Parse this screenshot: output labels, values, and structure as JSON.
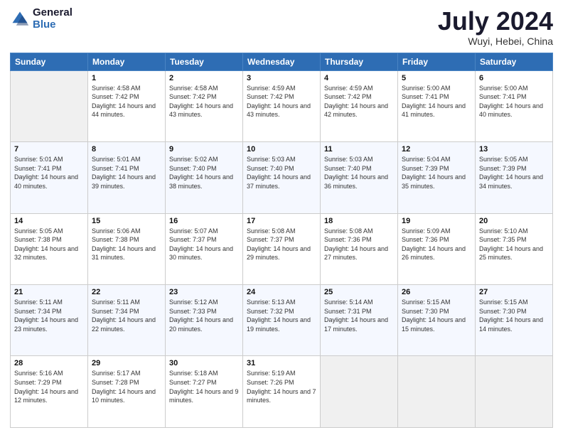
{
  "header": {
    "logo_general": "General",
    "logo_blue": "Blue",
    "month": "July 2024",
    "location": "Wuyi, Hebei, China"
  },
  "days_of_week": [
    "Sunday",
    "Monday",
    "Tuesday",
    "Wednesday",
    "Thursday",
    "Friday",
    "Saturday"
  ],
  "weeks": [
    [
      {
        "day": "",
        "sunrise": "",
        "sunset": "",
        "daylight": ""
      },
      {
        "day": "1",
        "sunrise": "Sunrise: 4:58 AM",
        "sunset": "Sunset: 7:42 PM",
        "daylight": "Daylight: 14 hours and 44 minutes."
      },
      {
        "day": "2",
        "sunrise": "Sunrise: 4:58 AM",
        "sunset": "Sunset: 7:42 PM",
        "daylight": "Daylight: 14 hours and 43 minutes."
      },
      {
        "day": "3",
        "sunrise": "Sunrise: 4:59 AM",
        "sunset": "Sunset: 7:42 PM",
        "daylight": "Daylight: 14 hours and 43 minutes."
      },
      {
        "day": "4",
        "sunrise": "Sunrise: 4:59 AM",
        "sunset": "Sunset: 7:42 PM",
        "daylight": "Daylight: 14 hours and 42 minutes."
      },
      {
        "day": "5",
        "sunrise": "Sunrise: 5:00 AM",
        "sunset": "Sunset: 7:41 PM",
        "daylight": "Daylight: 14 hours and 41 minutes."
      },
      {
        "day": "6",
        "sunrise": "Sunrise: 5:00 AM",
        "sunset": "Sunset: 7:41 PM",
        "daylight": "Daylight: 14 hours and 40 minutes."
      }
    ],
    [
      {
        "day": "7",
        "sunrise": "Sunrise: 5:01 AM",
        "sunset": "Sunset: 7:41 PM",
        "daylight": "Daylight: 14 hours and 40 minutes."
      },
      {
        "day": "8",
        "sunrise": "Sunrise: 5:01 AM",
        "sunset": "Sunset: 7:41 PM",
        "daylight": "Daylight: 14 hours and 39 minutes."
      },
      {
        "day": "9",
        "sunrise": "Sunrise: 5:02 AM",
        "sunset": "Sunset: 7:40 PM",
        "daylight": "Daylight: 14 hours and 38 minutes."
      },
      {
        "day": "10",
        "sunrise": "Sunrise: 5:03 AM",
        "sunset": "Sunset: 7:40 PM",
        "daylight": "Daylight: 14 hours and 37 minutes."
      },
      {
        "day": "11",
        "sunrise": "Sunrise: 5:03 AM",
        "sunset": "Sunset: 7:40 PM",
        "daylight": "Daylight: 14 hours and 36 minutes."
      },
      {
        "day": "12",
        "sunrise": "Sunrise: 5:04 AM",
        "sunset": "Sunset: 7:39 PM",
        "daylight": "Daylight: 14 hours and 35 minutes."
      },
      {
        "day": "13",
        "sunrise": "Sunrise: 5:05 AM",
        "sunset": "Sunset: 7:39 PM",
        "daylight": "Daylight: 14 hours and 34 minutes."
      }
    ],
    [
      {
        "day": "14",
        "sunrise": "Sunrise: 5:05 AM",
        "sunset": "Sunset: 7:38 PM",
        "daylight": "Daylight: 14 hours and 32 minutes."
      },
      {
        "day": "15",
        "sunrise": "Sunrise: 5:06 AM",
        "sunset": "Sunset: 7:38 PM",
        "daylight": "Daylight: 14 hours and 31 minutes."
      },
      {
        "day": "16",
        "sunrise": "Sunrise: 5:07 AM",
        "sunset": "Sunset: 7:37 PM",
        "daylight": "Daylight: 14 hours and 30 minutes."
      },
      {
        "day": "17",
        "sunrise": "Sunrise: 5:08 AM",
        "sunset": "Sunset: 7:37 PM",
        "daylight": "Daylight: 14 hours and 29 minutes."
      },
      {
        "day": "18",
        "sunrise": "Sunrise: 5:08 AM",
        "sunset": "Sunset: 7:36 PM",
        "daylight": "Daylight: 14 hours and 27 minutes."
      },
      {
        "day": "19",
        "sunrise": "Sunrise: 5:09 AM",
        "sunset": "Sunset: 7:36 PM",
        "daylight": "Daylight: 14 hours and 26 minutes."
      },
      {
        "day": "20",
        "sunrise": "Sunrise: 5:10 AM",
        "sunset": "Sunset: 7:35 PM",
        "daylight": "Daylight: 14 hours and 25 minutes."
      }
    ],
    [
      {
        "day": "21",
        "sunrise": "Sunrise: 5:11 AM",
        "sunset": "Sunset: 7:34 PM",
        "daylight": "Daylight: 14 hours and 23 minutes."
      },
      {
        "day": "22",
        "sunrise": "Sunrise: 5:11 AM",
        "sunset": "Sunset: 7:34 PM",
        "daylight": "Daylight: 14 hours and 22 minutes."
      },
      {
        "day": "23",
        "sunrise": "Sunrise: 5:12 AM",
        "sunset": "Sunset: 7:33 PM",
        "daylight": "Daylight: 14 hours and 20 minutes."
      },
      {
        "day": "24",
        "sunrise": "Sunrise: 5:13 AM",
        "sunset": "Sunset: 7:32 PM",
        "daylight": "Daylight: 14 hours and 19 minutes."
      },
      {
        "day": "25",
        "sunrise": "Sunrise: 5:14 AM",
        "sunset": "Sunset: 7:31 PM",
        "daylight": "Daylight: 14 hours and 17 minutes."
      },
      {
        "day": "26",
        "sunrise": "Sunrise: 5:15 AM",
        "sunset": "Sunset: 7:30 PM",
        "daylight": "Daylight: 14 hours and 15 minutes."
      },
      {
        "day": "27",
        "sunrise": "Sunrise: 5:15 AM",
        "sunset": "Sunset: 7:30 PM",
        "daylight": "Daylight: 14 hours and 14 minutes."
      }
    ],
    [
      {
        "day": "28",
        "sunrise": "Sunrise: 5:16 AM",
        "sunset": "Sunset: 7:29 PM",
        "daylight": "Daylight: 14 hours and 12 minutes."
      },
      {
        "day": "29",
        "sunrise": "Sunrise: 5:17 AM",
        "sunset": "Sunset: 7:28 PM",
        "daylight": "Daylight: 14 hours and 10 minutes."
      },
      {
        "day": "30",
        "sunrise": "Sunrise: 5:18 AM",
        "sunset": "Sunset: 7:27 PM",
        "daylight": "Daylight: 14 hours and 9 minutes."
      },
      {
        "day": "31",
        "sunrise": "Sunrise: 5:19 AM",
        "sunset": "Sunset: 7:26 PM",
        "daylight": "Daylight: 14 hours and 7 minutes."
      },
      {
        "day": "",
        "sunrise": "",
        "sunset": "",
        "daylight": ""
      },
      {
        "day": "",
        "sunrise": "",
        "sunset": "",
        "daylight": ""
      },
      {
        "day": "",
        "sunrise": "",
        "sunset": "",
        "daylight": ""
      }
    ]
  ]
}
